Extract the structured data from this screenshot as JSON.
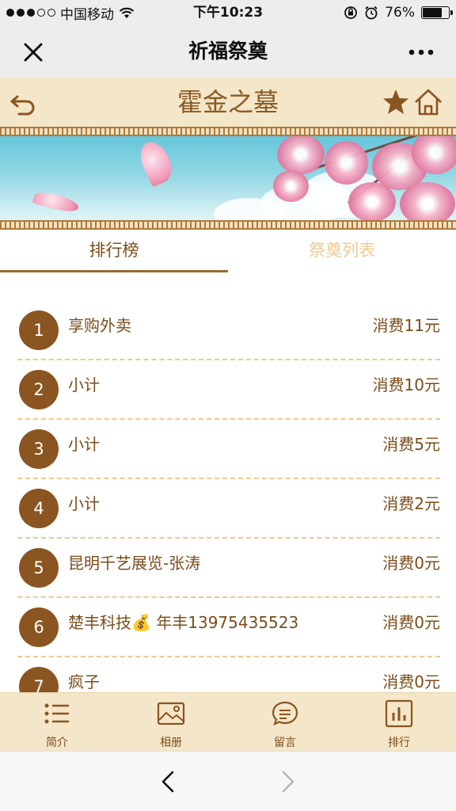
{
  "status_bar": {
    "carrier": "中国移动",
    "time": "下午10:23",
    "battery": "76%",
    "battery_level": 0.76
  },
  "nav": {
    "title": "祈福祭奠",
    "close_icon": "close-icon",
    "more_icon": "more-icon"
  },
  "header": {
    "title": "霍金之墓"
  },
  "tabs": [
    {
      "label": "排行榜",
      "active": true
    },
    {
      "label": "祭奠列表",
      "active": false
    }
  ],
  "ranking": [
    {
      "rank": "1",
      "name": "享购外卖",
      "amount": "消费11元"
    },
    {
      "rank": "2",
      "name": "小计",
      "amount": "消费10元"
    },
    {
      "rank": "3",
      "name": "小计",
      "amount": "消费5元"
    },
    {
      "rank": "4",
      "name": "小计",
      "amount": "消费2元"
    },
    {
      "rank": "5",
      "name": "昆明千艺展览-张涛",
      "amount": "消费0元"
    },
    {
      "rank": "6",
      "name": "楚丰科技💰 年丰13975435523",
      "amount": "消费0元"
    },
    {
      "rank": "7",
      "name": "疯子",
      "amount": "消费0元"
    }
  ],
  "bottom_tabs": [
    {
      "label": "简介",
      "icon": "list-icon"
    },
    {
      "label": "相册",
      "icon": "image-icon"
    },
    {
      "label": "留言",
      "icon": "chat-bubble-icon"
    },
    {
      "label": "排行",
      "icon": "bar-chart-icon"
    }
  ],
  "colors": {
    "accent": "#8a5520",
    "header_bg": "#f4e6c8",
    "text_brown": "#7b4d1b",
    "inactive_tab": "#f0c98e"
  }
}
